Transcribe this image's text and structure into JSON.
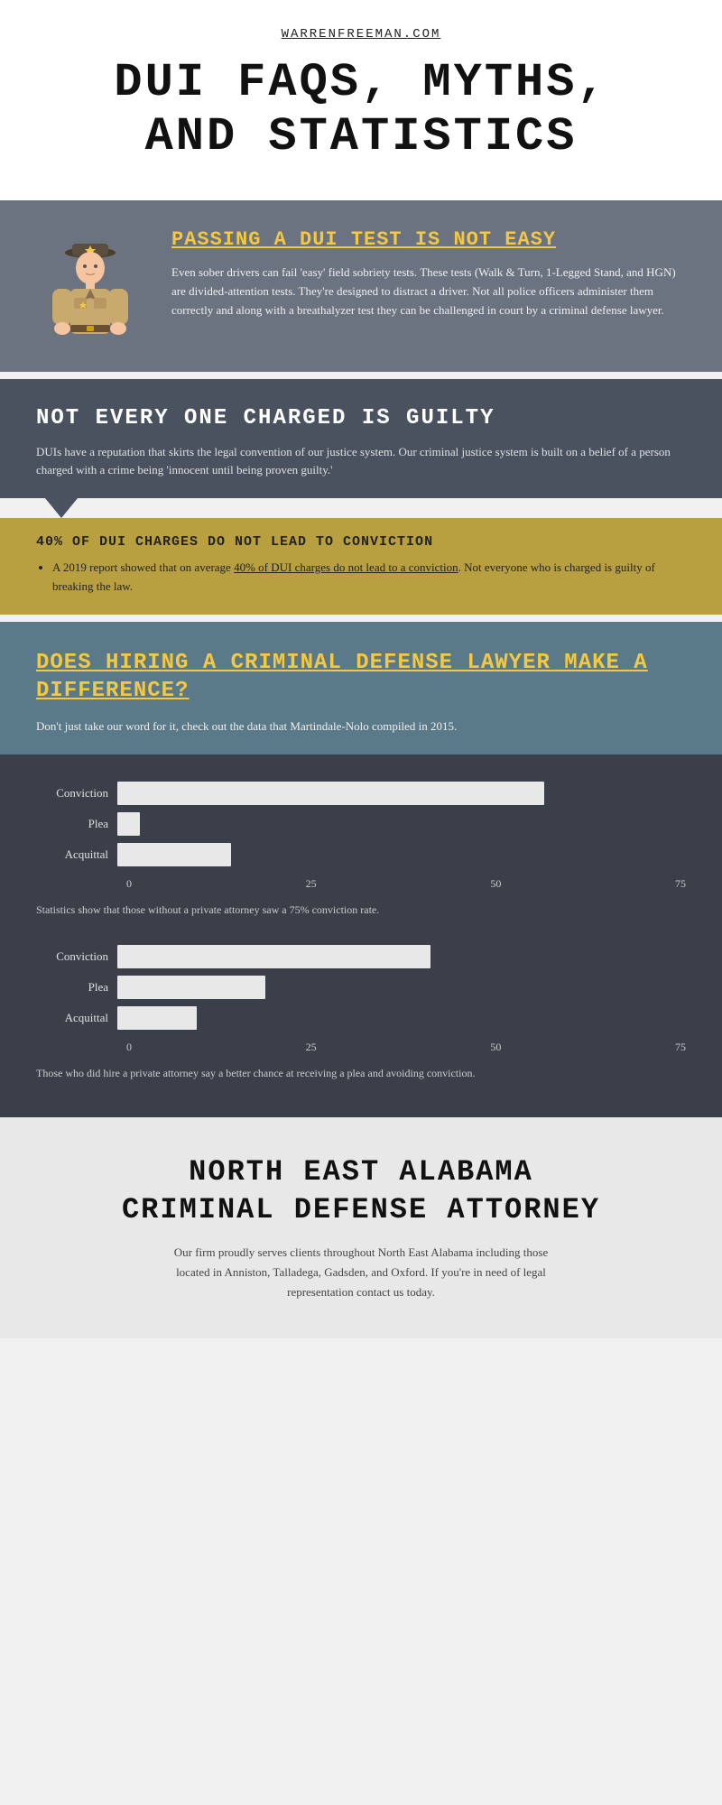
{
  "header": {
    "site_url": "WARRENFREEMAN.COM",
    "title_line1": "DUI FAQS, MYTHS,",
    "title_line2": "AND STATISTICS"
  },
  "section_dui_test": {
    "title": "PASSING A DUI TEST IS NOT EASY",
    "body": "Even sober drivers can fail 'easy' field sobriety tests. These tests (Walk & Turn, 1-Legged Stand, and HGN) are divided-attention tests. They're designed to distract a driver. Not all police officers administer them correctly and along with a breathalyzer test they can be challenged in court by a criminal defense lawyer."
  },
  "section_not_guilty": {
    "title": "NOT EVERY ONE CHARGED IS GUILTY",
    "body": "DUIs have a reputation that skirts the legal convention of our justice system. Our criminal justice system is built on a belief of a person charged with a crime being 'innocent until being proven guilty.'"
  },
  "section_forty": {
    "title": "40% OF DUI CHARGES DO NOT LEAD TO CONVICTION",
    "body_prefix": "A 2019 report showed that on average ",
    "link_text": "40% of DUI charges do not lead to a conviction",
    "body_suffix": ". Not everyone who is charged is guilty of breaking the law."
  },
  "section_hiring": {
    "title": "DOES HIRING A CRIMINAL DEFENSE LAWYER MAKE A DIFFERENCE?",
    "body": "Don't just take our word for it, check out the data that Martindale-Nolo compiled in 2015."
  },
  "chart1": {
    "caption": "Statistics show that those without a private attorney saw a 75% conviction rate.",
    "bars": [
      {
        "label": "Conviction",
        "value": 75,
        "max": 100
      },
      {
        "label": "Plea",
        "value": 4,
        "max": 100
      },
      {
        "label": "Acquittal",
        "value": 18,
        "max": 100
      }
    ],
    "x_labels": [
      "0",
      "25",
      "50",
      "75"
    ]
  },
  "chart2": {
    "caption": "Those who did hire a private attorney say a better chance at receiving a plea and avoiding conviction.",
    "bars": [
      {
        "label": "Conviction",
        "value": 55,
        "max": 100
      },
      {
        "label": "Plea",
        "value": 24,
        "max": 100
      },
      {
        "label": "Acquittal",
        "value": 14,
        "max": 100
      }
    ],
    "x_labels": [
      "0",
      "25",
      "50",
      "75"
    ]
  },
  "section_ne_alabama": {
    "title_line1": "NORTH EAST ALABAMA",
    "title_line2": "CRIMINAL DEFENSE ATTORNEY",
    "body": "Our firm proudly serves clients throughout North East Alabama including those located in Anniston, Talladega, Gadsden, and Oxford. If you're in need of legal representation contact us today."
  }
}
